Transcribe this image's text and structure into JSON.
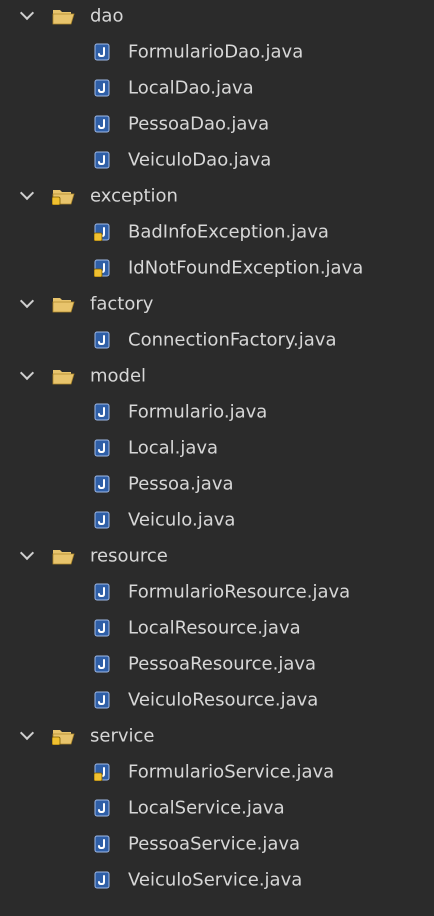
{
  "tree": [
    {
      "label": "dao",
      "kind": "folder",
      "marker": false
    },
    {
      "label": "FormularioDao.java",
      "kind": "file",
      "marker": false
    },
    {
      "label": "LocalDao.java",
      "kind": "file",
      "marker": false
    },
    {
      "label": "PessoaDao.java",
      "kind": "file",
      "marker": false
    },
    {
      "label": "VeiculoDao.java",
      "kind": "file",
      "marker": false
    },
    {
      "label": "exception",
      "kind": "folder",
      "marker": true
    },
    {
      "label": "BadInfoException.java",
      "kind": "file",
      "marker": true
    },
    {
      "label": "IdNotFoundException.java",
      "kind": "file",
      "marker": true
    },
    {
      "label": "factory",
      "kind": "folder",
      "marker": false
    },
    {
      "label": "ConnectionFactory.java",
      "kind": "file",
      "marker": false
    },
    {
      "label": "model",
      "kind": "folder",
      "marker": false
    },
    {
      "label": "Formulario.java",
      "kind": "file",
      "marker": false
    },
    {
      "label": "Local.java",
      "kind": "file",
      "marker": false
    },
    {
      "label": "Pessoa.java",
      "kind": "file",
      "marker": false
    },
    {
      "label": "Veiculo.java",
      "kind": "file",
      "marker": false
    },
    {
      "label": "resource",
      "kind": "folder",
      "marker": false
    },
    {
      "label": "FormularioResource.java",
      "kind": "file",
      "marker": false
    },
    {
      "label": "LocalResource.java",
      "kind": "file",
      "marker": false
    },
    {
      "label": "PessoaResource.java",
      "kind": "file",
      "marker": false
    },
    {
      "label": "VeiculoResource.java",
      "kind": "file",
      "marker": false
    },
    {
      "label": "service",
      "kind": "folder",
      "marker": true
    },
    {
      "label": "FormularioService.java",
      "kind": "file",
      "marker": true
    },
    {
      "label": "LocalService.java",
      "kind": "file",
      "marker": false
    },
    {
      "label": "PessoaService.java",
      "kind": "file",
      "marker": false
    },
    {
      "label": "VeiculoService.java",
      "kind": "file",
      "marker": false
    }
  ],
  "icons": {
    "folder": "open-folder-icon",
    "file": "java-file-icon",
    "marker": "warning-marker-icon",
    "expand": "chevron-down-icon"
  },
  "colors": {
    "background": "#2b2b2b",
    "text": "#d7d7d7",
    "folder": "#e8c46c",
    "file_bg": "#2f5fa7",
    "marker": "#f0c030"
  }
}
